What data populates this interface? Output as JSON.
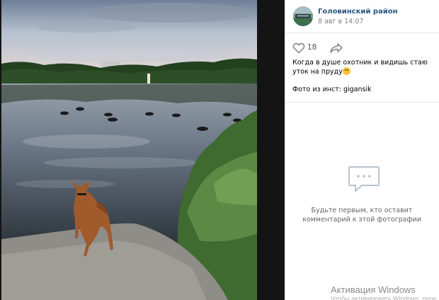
{
  "post": {
    "group_name": "Головинский район",
    "date": "8 авг в 14:07",
    "likes": "18",
    "text": "Когда в душе охотник и видишь стаю уток на пруду",
    "credit": "Фото из инст: gigansik"
  },
  "comments": {
    "empty_line1": "Будьте первым, кто оставит",
    "empty_line2": "комментарий к этой фотографии"
  },
  "watermark": {
    "title": "Активация Windows",
    "subtitle": "Чтобы активировать Windows, перейдите"
  },
  "icons": {
    "like": "heart-outline-icon",
    "share": "share-arrow-icon",
    "comments": "speech-bubble-icon"
  },
  "colors": {
    "link": "#2a5885",
    "muted": "#828282",
    "icon": "#99a2ad"
  }
}
